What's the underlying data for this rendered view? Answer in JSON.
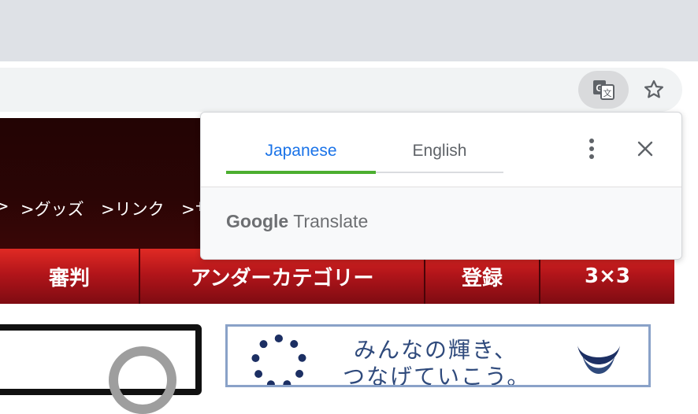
{
  "browser": {
    "translate_icon": "google-translate-icon",
    "bookmark_icon": "star-icon"
  },
  "page": {
    "sublinks": [
      ">",
      ">グッズ",
      ">リンク",
      ">サ"
    ],
    "nav_items": [
      "審判",
      "アンダーカテゴリー",
      "登録",
      "3×3"
    ],
    "banner_line1": "みんなの輝き、",
    "banner_line2": "つなげていこう。"
  },
  "translate_popup": {
    "tabs": [
      {
        "label": "Japanese",
        "selected": true
      },
      {
        "label": "English",
        "selected": false
      }
    ],
    "more_icon": "more-vert-icon",
    "close_icon": "close-icon",
    "brand_google": "Google",
    "brand_translate": "Translate"
  },
  "colors": {
    "active_tab_text": "#1a73e8",
    "active_tab_underline": "#4caf30",
    "nav_red": "#b3151a",
    "header_dark": "#230404"
  }
}
